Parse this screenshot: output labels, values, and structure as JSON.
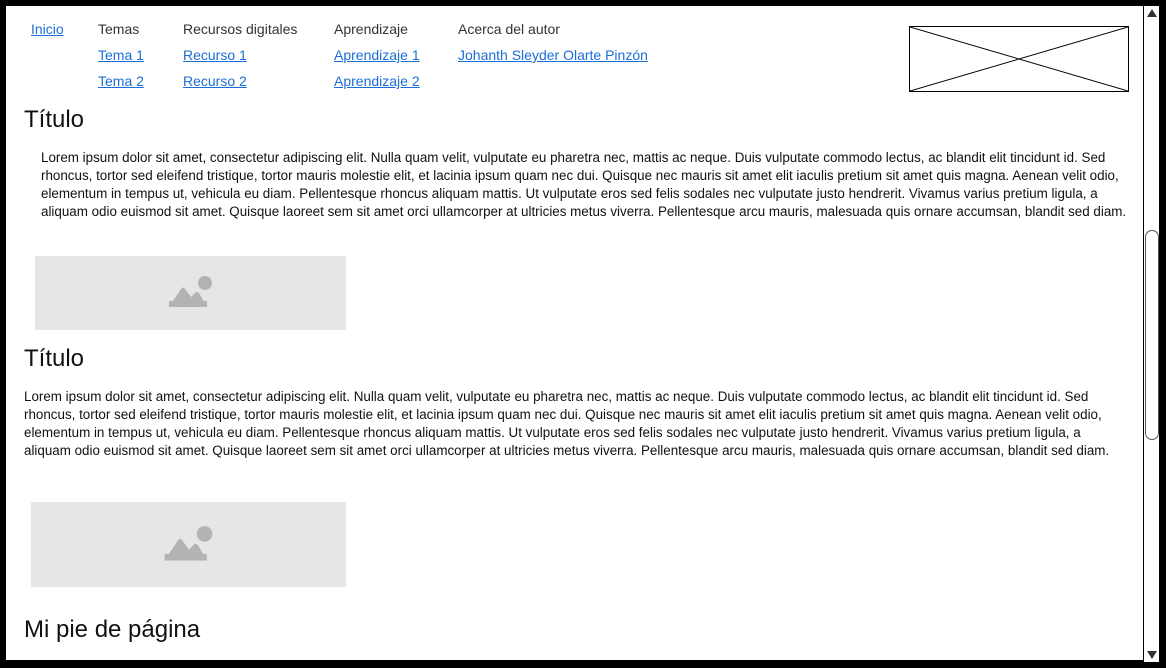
{
  "nav": {
    "home_label": "Inicio",
    "columns": [
      {
        "heading": "Temas",
        "links": [
          "Tema 1",
          "Tema 2"
        ]
      },
      {
        "heading": "Recursos digitales",
        "links": [
          "Recurso 1",
          "Recurso 2"
        ]
      },
      {
        "heading": "Aprendizaje",
        "links": [
          "Aprendizaje 1",
          "Aprendizaje 2"
        ]
      },
      {
        "heading": "Acerca del autor",
        "links": [
          "Johanth Sleyder Olarte Pinzón"
        ]
      }
    ]
  },
  "sections": [
    {
      "title": "Título",
      "body": "Lorem ipsum dolor sit amet, consectetur adipiscing elit. Nulla quam velit, vulputate eu pharetra nec, mattis ac neque. Duis vulputate commodo lectus, ac blandit elit tincidunt id. Sed rhoncus, tortor sed eleifend tristique, tortor mauris molestie elit, et lacinia ipsum quam nec dui. Quisque nec mauris sit amet elit iaculis pretium sit amet quis magna. Aenean velit odio, elementum in tempus ut, vehicula eu diam. Pellentesque rhoncus aliquam mattis. Ut vulputate eros sed felis sodales nec vulputate justo hendrerit. Vivamus varius pretium ligula, a aliquam odio euismod sit amet. Quisque laoreet sem sit amet orci ullamcorper at ultricies metus viverra. Pellentesque arcu mauris, malesuada quis ornare accumsan, blandit sed diam."
    },
    {
      "title": "Título",
      "body": "Lorem ipsum dolor sit amet, consectetur adipiscing elit. Nulla quam velit, vulputate eu pharetra nec, mattis ac neque. Duis vulputate commodo lectus, ac blandit elit tincidunt id. Sed rhoncus, tortor sed eleifend tristique, tortor mauris molestie elit, et lacinia ipsum quam nec dui. Quisque nec mauris sit amet elit iaculis pretium sit amet quis magna. Aenean velit odio, elementum in tempus ut, vehicula eu diam. Pellentesque rhoncus aliquam mattis. Ut vulputate eros sed felis sodales nec vulputate justo hendrerit. Vivamus varius pretium ligula, a aliquam odio euismod sit amet. Quisque laoreet sem sit amet orci ullamcorper at ultricies metus viverra. Pellentesque arcu mauris, malesuada quis ornare accumsan, blandit sed diam."
    }
  ],
  "footer": {
    "title": "Mi pie de página"
  },
  "colors": {
    "link": "#1a6ed6",
    "image_placeholder": "#e6e6e6",
    "frame": "#000000"
  },
  "icons": [
    "image-placeholder-icon",
    "logo-placeholder-icon",
    "scroll-up-icon",
    "scroll-down-icon"
  ]
}
